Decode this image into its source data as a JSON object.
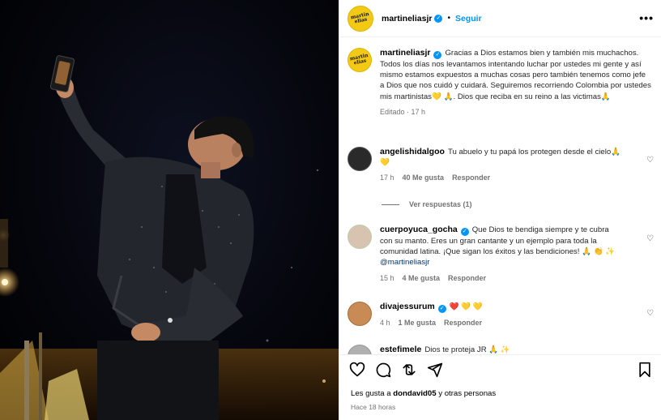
{
  "post": {
    "username": "martineliasjr",
    "follow_label": "Seguir",
    "more_label": "•••",
    "avatar_logo": "martin elias"
  },
  "caption": {
    "username": "martineliasjr",
    "text": "Gracias a Dios estamos bien y también mis muchachos. Todos los días nos levantamos intentando luchar por ustedes mi gente y así mismo estamos expuestos a muchas cosas pero también tenemos como jefe a Dios que nos cuidó y cuidará. Seguiremos recorriendo Colombia por ustedes mis martinistas💛 🙏. Dios que reciba en su reino a las victimas🙏",
    "meta": "Editado · 17 h"
  },
  "comments": [
    {
      "username": "angelishidalgoo",
      "verified": false,
      "text": "Tu abuelo y tu papá los protegen desde el cielo🙏 💛",
      "mention": "",
      "time": "17 h",
      "likes": "40 Me gusta",
      "reply": "Responder",
      "avatar_color": "#2a2a2a"
    },
    {
      "username": "cuerpoyuca_gocha",
      "verified": true,
      "text": "Que Dios te bendiga siempre y te cubra con su manto. Eres un gran cantante y un ejemplo para toda la comunidad latina. ¡Que sigan los éxitos y las bendiciones! 🙏 👏 ✨",
      "mention": "@martineliasjr",
      "time": "15 h",
      "likes": "4 Me gusta",
      "reply": "Responder",
      "avatar_color": "#d8c3b0"
    },
    {
      "username": "divajessurum",
      "verified": true,
      "text": "❤️ 💛 💛",
      "mention": "",
      "time": "4 h",
      "likes": "1 Me gusta",
      "reply": "Responder",
      "avatar_color": "#c98b55"
    },
    {
      "username": "estefimele",
      "verified": false,
      "text": "Dios te proteja JR 🙏 ✨",
      "mention": "",
      "time": "",
      "likes": "",
      "reply": "",
      "avatar_color": "#b0b0b0"
    }
  ],
  "view_replies_label": "Ver respuestas (1)",
  "footer": {
    "likes_prefix": "Les gusta a ",
    "likes_user": "dondavid05",
    "likes_suffix": " y otras personas",
    "time": "Hace 18 horas"
  },
  "icons": {
    "like": "heart-icon",
    "comment": "comment-icon",
    "share": "share-icon",
    "send": "send-icon",
    "save": "bookmark-icon"
  },
  "colors": {
    "accent": "#0095f6",
    "avatar_bg": "#f2c914",
    "muted": "#737373"
  }
}
